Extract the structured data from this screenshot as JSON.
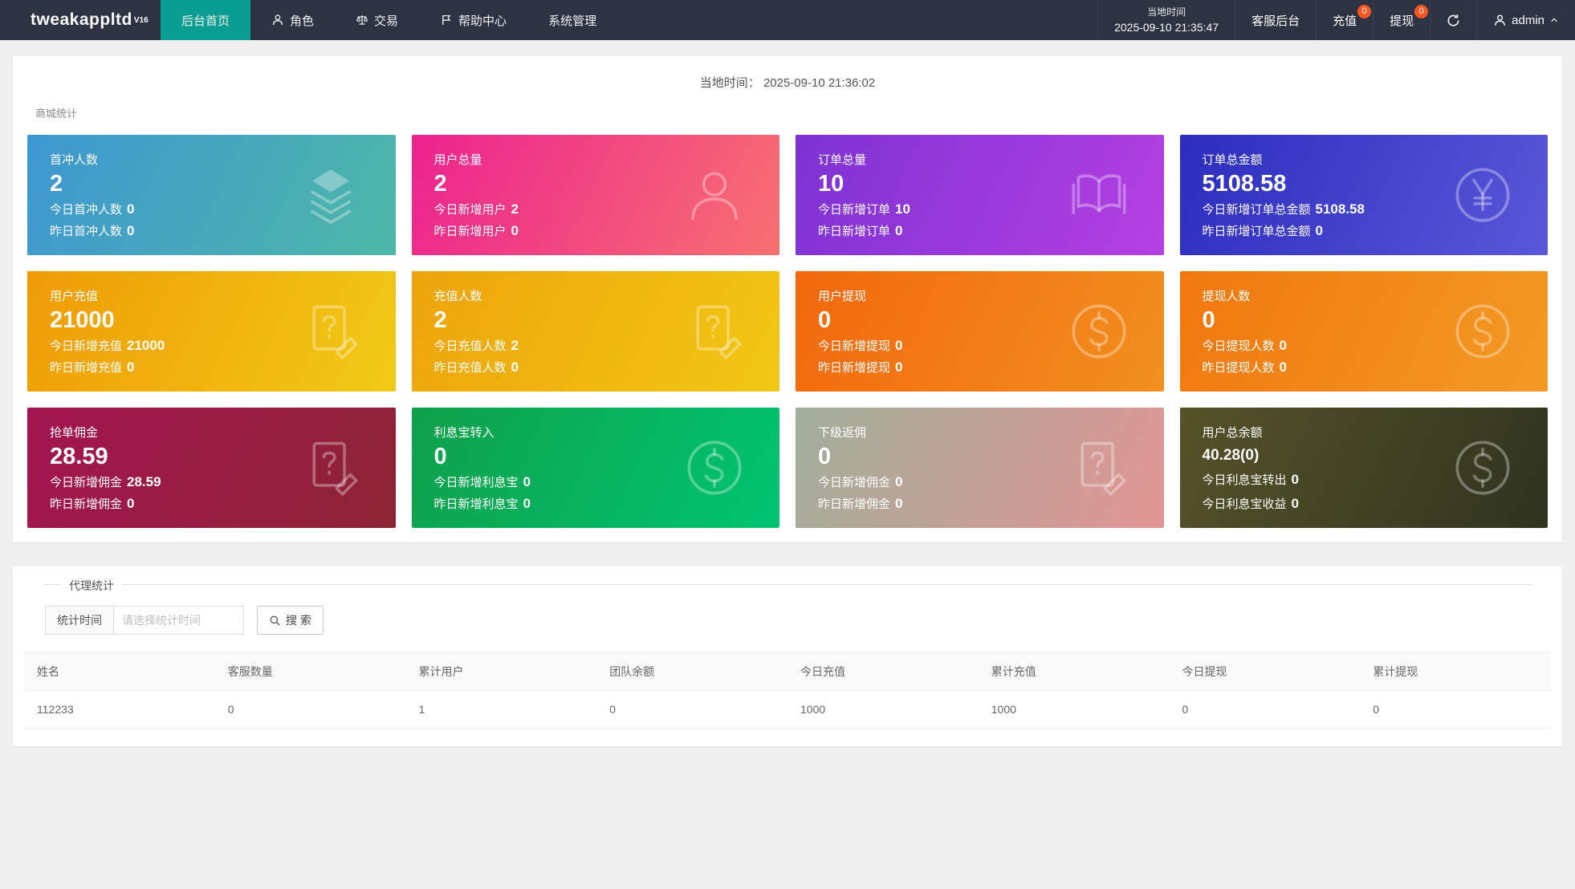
{
  "navbar": {
    "logo": "tweakappltd",
    "logo_version": "V16",
    "menu": [
      {
        "label": "后台首页",
        "icon": "none",
        "active": true
      },
      {
        "label": "角色",
        "icon": "person",
        "active": false
      },
      {
        "label": "交易",
        "icon": "scales",
        "active": false
      },
      {
        "label": "帮助中心",
        "icon": "flag",
        "active": false
      },
      {
        "label": "系统管理",
        "icon": "none",
        "active": false
      }
    ],
    "local_time_label": "当地时间",
    "local_time_value": "2025-09-10 21:35:47",
    "service_label": "客服后台",
    "recharge_label": "充值",
    "recharge_badge": "0",
    "withdraw_label": "提现",
    "withdraw_badge": "0",
    "user_name": "admin"
  },
  "content": {
    "local_time_line_label": "当地时间：",
    "local_time_line_value": "2025-09-10 21:36:02",
    "mall_stats_title": "商城统计",
    "cards": [
      {
        "title": "首冲人数",
        "value": "2",
        "line1_label": "今日首冲人数",
        "line1_value": "0",
        "line2_label": "昨日首冲人数",
        "line2_value": "0",
        "icon": "layers",
        "gradient": [
          "#3e97d1",
          "#4eb7a7"
        ]
      },
      {
        "title": "用户总量",
        "value": "2",
        "line1_label": "今日新增用户",
        "line1_value": "2",
        "line2_label": "昨日新增用户",
        "line2_value": "0",
        "icon": "user",
        "gradient": [
          "#ec2290",
          "#f77070"
        ]
      },
      {
        "title": "订单总量",
        "value": "10",
        "line1_label": "今日新增订单",
        "line1_value": "10",
        "line2_label": "昨日新增订单",
        "line2_value": "0",
        "icon": "book",
        "gradient": [
          "#7d32d3",
          "#b540e2"
        ]
      },
      {
        "title": "订单总金额",
        "value": "5108.58",
        "line1_label": "今日新增订单总金额",
        "line1_value": "5108.58",
        "line2_label": "昨日新增订单总金额",
        "line2_value": "0",
        "icon": "yen",
        "gradient": [
          "#2c2dbe",
          "#5a57d8"
        ]
      },
      {
        "title": "用户充值",
        "value": "21000",
        "line1_label": "今日新增充值",
        "line1_value": "21000",
        "line2_label": "昨日新增充值",
        "line2_value": "0",
        "icon": "doc-edit",
        "gradient": [
          "#ef9b06",
          "#f0ca16"
        ]
      },
      {
        "title": "充值人数",
        "value": "2",
        "line1_label": "今日充值人数",
        "line1_value": "2",
        "line2_label": "昨日充值人数",
        "line2_value": "0",
        "icon": "doc-edit",
        "gradient": [
          "#eda40b",
          "#f1c714"
        ]
      },
      {
        "title": "用户提现",
        "value": "0",
        "line1_label": "今日新增提现",
        "line1_value": "0",
        "line2_label": "昨日新增提现",
        "line2_value": "0",
        "icon": "dollar",
        "gradient": [
          "#f2680d",
          "#f18f1f"
        ]
      },
      {
        "title": "提现人数",
        "value": "0",
        "line1_label": "今日提现人数",
        "line1_value": "0",
        "line2_label": "昨日提现人数",
        "line2_value": "0",
        "icon": "dollar",
        "gradient": [
          "#f1770f",
          "#f29a24"
        ]
      },
      {
        "title": "抢单佣金",
        "value": "28.59",
        "line1_label": "今日新增佣金",
        "line1_value": "28.59",
        "line2_label": "昨日新增佣金",
        "line2_value": "0",
        "icon": "doc-edit",
        "gradient": [
          "#a31551",
          "#8c2434"
        ]
      },
      {
        "title": "利息宝转入",
        "value": "0",
        "line1_label": "今日新增利息宝",
        "line1_value": "0",
        "line2_label": "昨日新增利息宝",
        "line2_value": "0",
        "icon": "dollar",
        "gradient": [
          "#0fa04a",
          "#00c472"
        ]
      },
      {
        "title": "下级返佣",
        "value": "0",
        "line1_label": "今日新增佣金",
        "line1_value": "0",
        "line2_label": "昨日新增佣金",
        "line2_value": "0",
        "icon": "doc-edit",
        "gradient": [
          "#a0ae9a",
          "#e29494"
        ]
      },
      {
        "title": "用户总余额",
        "value": "40.28(0)",
        "line1_label": "今日利息宝转出",
        "line1_value": "0",
        "line2_label": "今日利息宝收益",
        "line2_value": "0",
        "icon": "dollar",
        "gradient": [
          "#565229",
          "#2f331f"
        ]
      }
    ]
  },
  "agent": {
    "title": "代理统计",
    "time_label": "统计时间",
    "time_placeholder": "请选择统计时间",
    "search_label": "搜 索",
    "table": {
      "headers": [
        "姓名",
        "客服数量",
        "累计用户",
        "团队余额",
        "今日充值",
        "累计充值",
        "今日提现",
        "累计提现"
      ],
      "rows": [
        [
          "112233",
          "0",
          "1",
          "0",
          "1000",
          "1000",
          "0",
          "0"
        ]
      ]
    }
  },
  "colors": {
    "navbar_bg": "#2d3343",
    "nav_active": "#0a9e92",
    "badge": "#ff5722",
    "page_bg": "#efefef"
  }
}
